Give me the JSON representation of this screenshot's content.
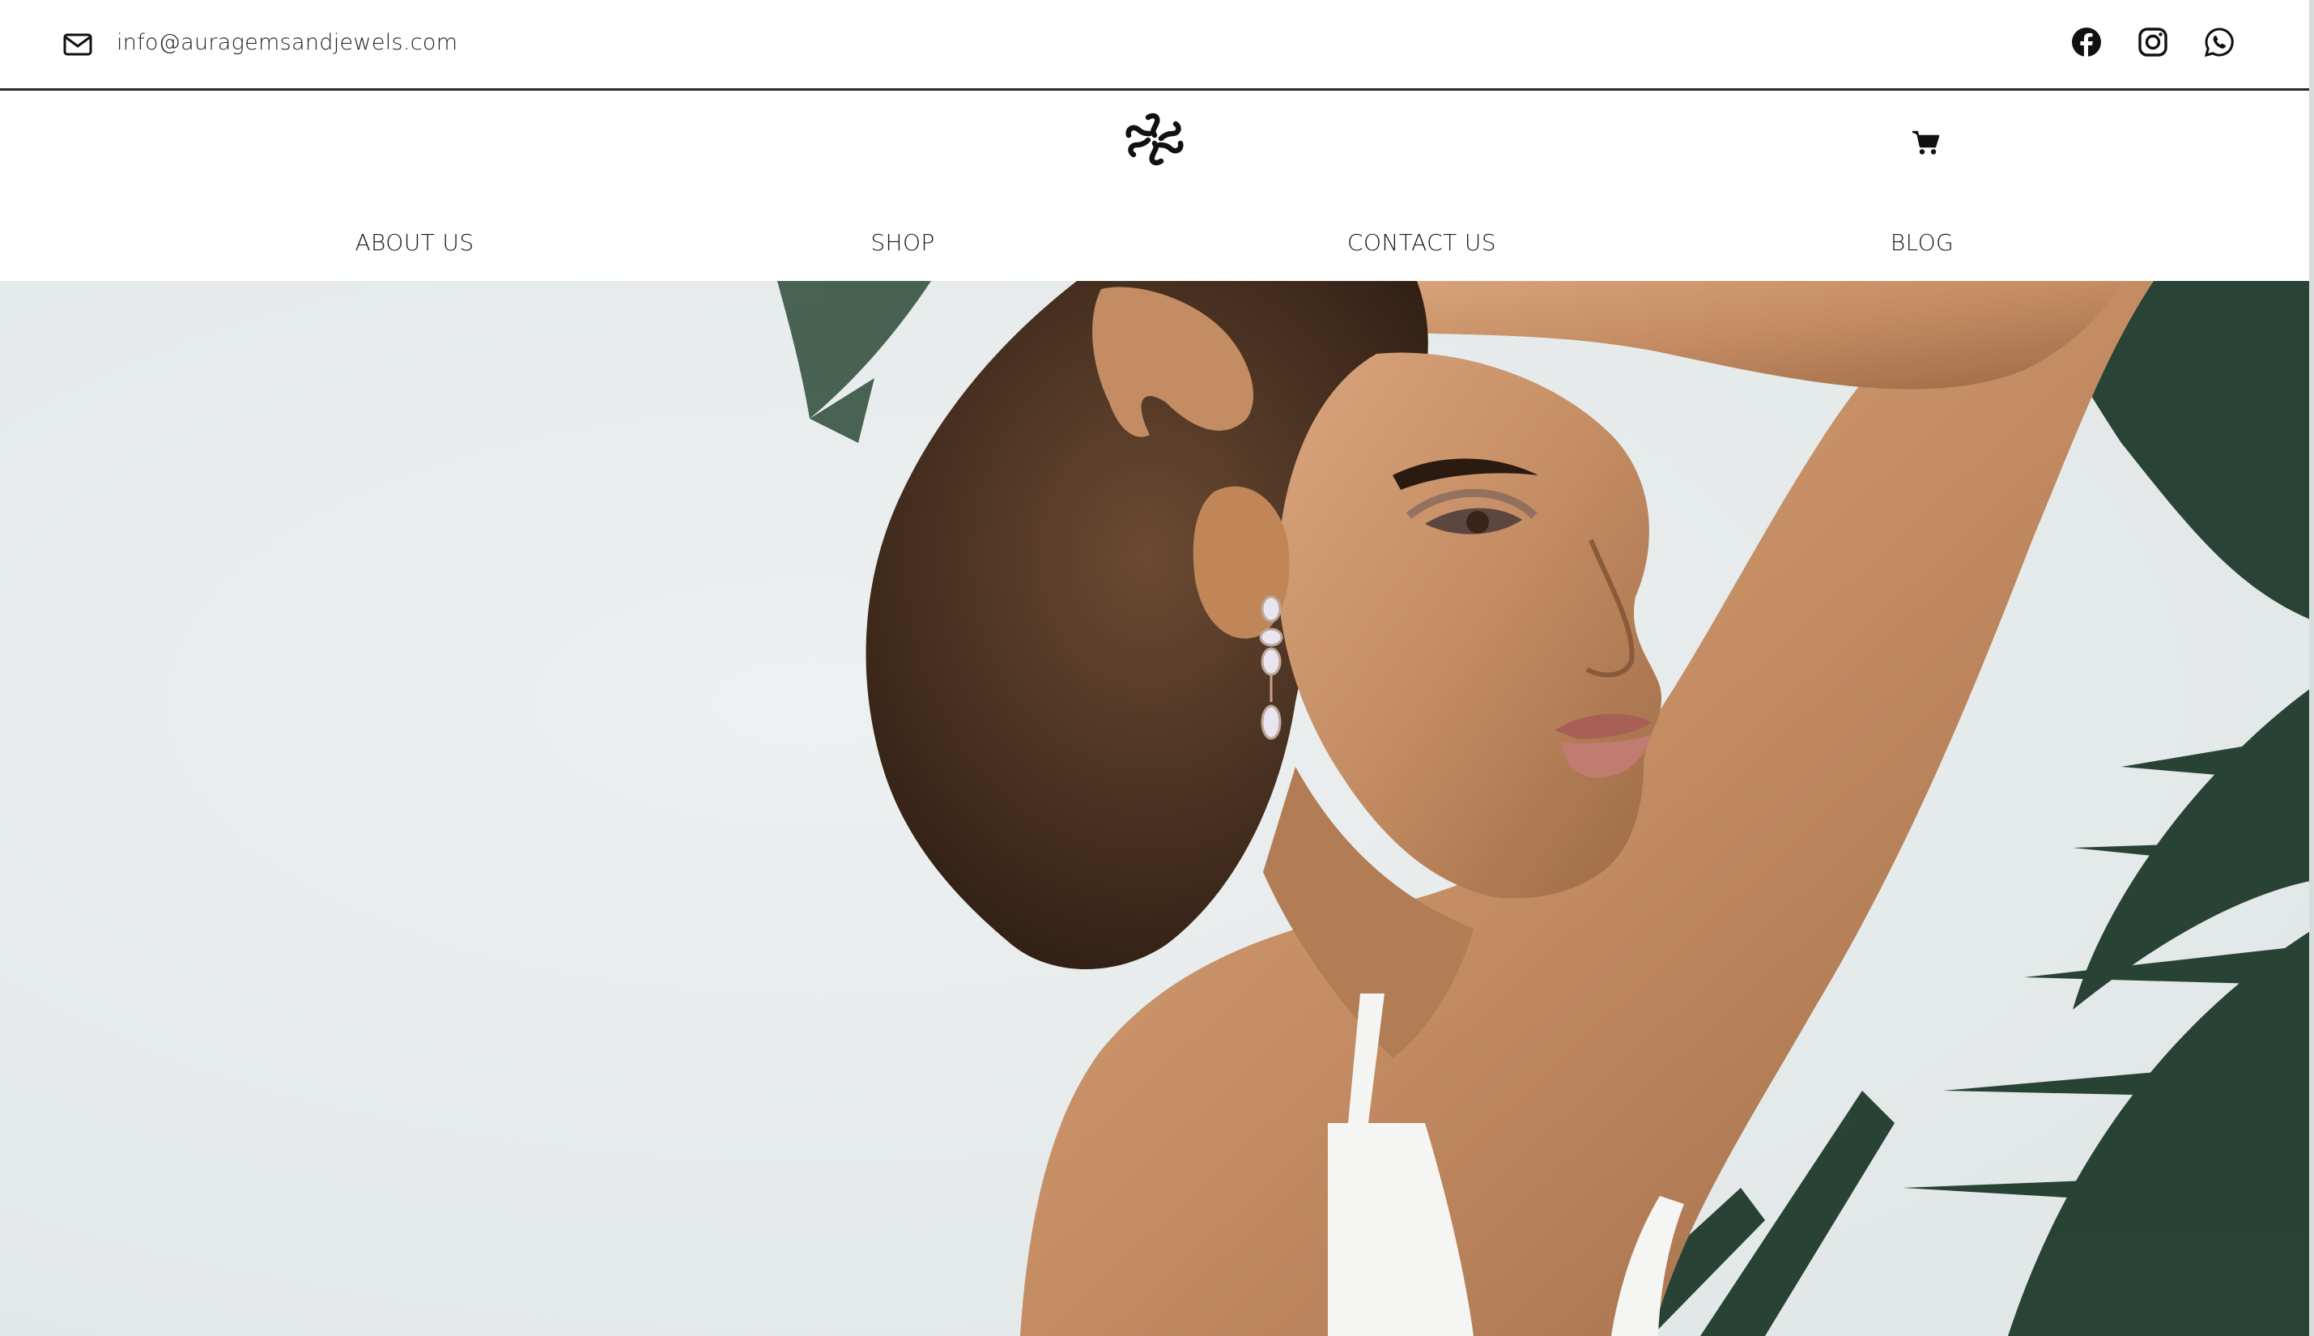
{
  "topbar": {
    "email": "info@auragemsandjewels.com",
    "mail_icon": "envelope-icon",
    "social": [
      {
        "name": "facebook-icon"
      },
      {
        "name": "instagram-icon"
      },
      {
        "name": "whatsapp-icon"
      }
    ]
  },
  "header": {
    "logo_icon": "flower-logo-icon",
    "cart_icon": "cart-icon"
  },
  "nav": {
    "items": [
      {
        "label": "ABOUT US"
      },
      {
        "label": "SHOP"
      },
      {
        "label": "CONTACT US"
      },
      {
        "label": "BLOG"
      }
    ]
  },
  "hero": {
    "image": "model-with-earring-and-palm-leaves",
    "colors": {
      "background": "#e6eaea",
      "skin": "#c48c63",
      "hair": "#3f2a1c",
      "leaves": "#1f3a2c"
    }
  }
}
